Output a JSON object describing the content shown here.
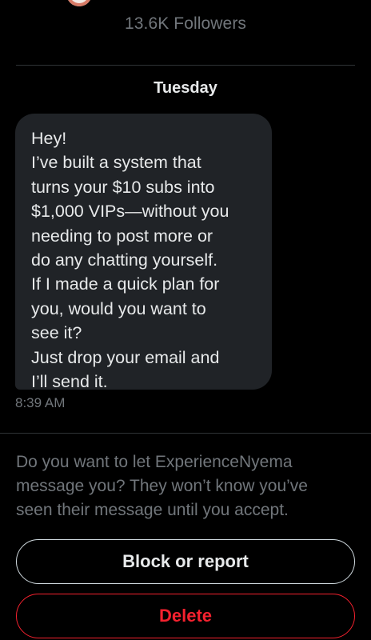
{
  "profile": {
    "followers": "13.6K Followers"
  },
  "conversation": {
    "day_label": "Tuesday",
    "message": {
      "text": "Hey!\nI’ve built a system that\nturns your $10 subs into\n$1,000 VIPs—without you\nneeding to post more or\ndo any chatting yourself.\nIf I made a quick plan for\nyou, would you want to\nsee it?\nJust drop your email and\nI’ll send it.",
      "time": "8:39 AM"
    }
  },
  "request": {
    "prompt": "Do you want to let ExperienceNyema\nmessage you? They won’t know you’ve\nseen their message until you accept.",
    "block_label": "Block or report",
    "delete_label": "Delete"
  },
  "colors": {
    "background": "#000000",
    "bubble": "#202327",
    "muted_text": "#71767b",
    "danger": "#f4212e"
  }
}
